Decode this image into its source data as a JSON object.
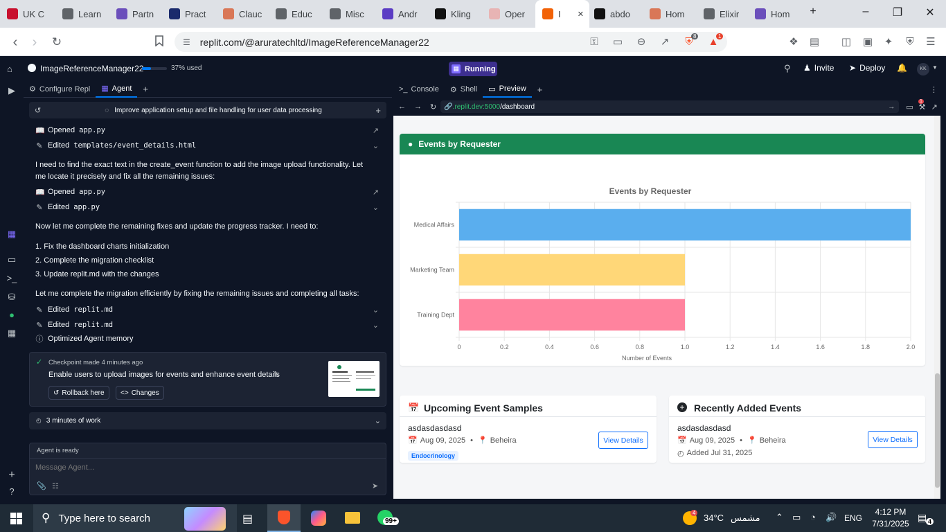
{
  "browser": {
    "tabs": [
      {
        "label": "UK C",
        "icon": "uk-flag-icon",
        "color": "#c8102e"
      },
      {
        "label": "Learn",
        "icon": "learn-icon",
        "color": "#5f6368"
      },
      {
        "label": "Partn",
        "icon": "partner-icon",
        "color": "#6b4fbb"
      },
      {
        "label": "Pract",
        "icon": "practice-icon",
        "color": "#1a2a6c"
      },
      {
        "label": "Clauc",
        "icon": "claude-icon",
        "color": "#d97757"
      },
      {
        "label": "Educ",
        "icon": "educ-icon",
        "color": "#5f6368"
      },
      {
        "label": "Misc",
        "icon": "misc-icon",
        "color": "#5f6368"
      },
      {
        "label": "Andr",
        "icon": "d-icon",
        "color": "#5b3cc4"
      },
      {
        "label": "Kling",
        "icon": "kling-icon",
        "color": "#111111"
      },
      {
        "label": "Oper",
        "icon": "openai-icon",
        "color": "#e8b4b4"
      },
      {
        "label": "I",
        "icon": "replit-icon",
        "color": "#f26207"
      },
      {
        "label": "abdo",
        "icon": "github-icon",
        "color": "#111111"
      },
      {
        "label": "Hom",
        "icon": "claude-icon",
        "color": "#d97757"
      },
      {
        "label": "Elixir",
        "icon": "elixir-icon",
        "color": "#5f6368"
      },
      {
        "label": "Hom",
        "icon": "h-icon",
        "color": "#6b4fbb"
      }
    ],
    "url": "replit.com/@aruratechltd/ImageReferenceManager22",
    "extension_badges": [
      "8",
      "1"
    ]
  },
  "replit": {
    "repl_name": "ImageReferenceManager22",
    "usage": "37% used",
    "usage_fraction": 0.37,
    "status": "Running",
    "invite": "Invite",
    "deploy": "Deploy",
    "avatar": "KK"
  },
  "left_panel": {
    "tabs": [
      "Configure Repl",
      "Agent"
    ],
    "thread_title": "Improve application setup and file handling for user data processing",
    "items": {
      "opened1": "Opened",
      "opened1_file": "app.py",
      "edited1": "Edited",
      "edited1_file": "templates/event_details.html",
      "msg1": "I need to find the exact text in the create_event function to add the image upload functionality. Let me locate it precisely and fix all the remaining issues:",
      "opened2": "Opened",
      "opened2_file": "app.py",
      "edited2": "Edited",
      "edited2_file": "app.py",
      "msg2": "Now let me complete the remaining fixes and update the progress tracker. I need to:",
      "list": [
        "1. Fix the dashboard charts initialization",
        "2. Complete the migration checklist",
        "3. Update replit.md with the changes"
      ],
      "msg3": "Let me complete the migration efficiently by fixing the remaining issues and completing all tasks:",
      "edited3": "Edited",
      "edited3_file": "replit.md",
      "edited4": "Edited",
      "edited4_file": "replit.md",
      "memory": "Optimized Agent memory"
    },
    "checkpoint": {
      "time": "Checkpoint made 4 minutes ago",
      "title": "Enable users to upload images for events and enhance event details",
      "rollback": "Rollback here",
      "changes": "Changes"
    },
    "work": "3 minutes of work",
    "agent_status": "Agent is ready",
    "input_placeholder": "Message Agent..."
  },
  "right_panel": {
    "tabs": [
      "Console",
      "Shell",
      "Preview"
    ],
    "url_host": ".replit.dev:5000",
    "url_path": "/dashboard",
    "devtools_badge": "1"
  },
  "dashboard": {
    "chart_card_title": "Events by Requester",
    "upcoming_title": "Upcoming Event Samples",
    "recent_title": "Recently Added Events",
    "upcoming": {
      "name": "asdasdasdasd",
      "date": "Aug 09, 2025",
      "location": "Beheira",
      "tag": "Endocrinology",
      "button": "View Details"
    },
    "recent": {
      "name": "asdasdasdasd",
      "date": "Aug 09, 2025",
      "location": "Beheira",
      "added": "Added Jul 31, 2025",
      "button": "View Details"
    }
  },
  "chart_data": {
    "type": "bar",
    "orientation": "horizontal",
    "title": "Events by Requester",
    "xlabel": "Number of Events",
    "categories": [
      "Medical Affairs",
      "Marketing Team",
      "Training Dept"
    ],
    "values": [
      2,
      1,
      1
    ],
    "colors": [
      "#5aaeee",
      "#ffd778",
      "#ff839e"
    ],
    "xlim": [
      0,
      2
    ],
    "ticks": [
      "0",
      "0.2",
      "0.4",
      "0.6",
      "0.8",
      "1.0",
      "1.2",
      "1.4",
      "1.6",
      "1.8",
      "2.0"
    ],
    "grid": true
  },
  "taskbar": {
    "search_placeholder": "Type here to search",
    "weather_temp": "34°C",
    "weather_place": "مشمس",
    "weather_badge": "4",
    "whatsapp_badge": "99+",
    "language": "ENG",
    "time": "4:12 PM",
    "date": "7/31/2025",
    "notification_count": "4"
  }
}
